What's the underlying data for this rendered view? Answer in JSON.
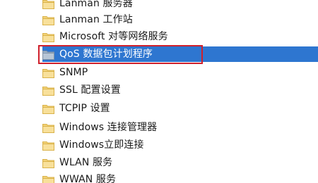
{
  "tree": {
    "items": [
      {
        "label": "Lanman 服务器",
        "icon": "folder-icon",
        "selected": false
      },
      {
        "label": "Lanman 工作站",
        "icon": "folder-icon",
        "selected": false
      },
      {
        "label": "Microsoft 对等网络服务",
        "icon": "folder-icon",
        "selected": false
      },
      {
        "label": "QoS 数据包计划程序",
        "icon": "folder-icon",
        "selected": true
      },
      {
        "label": "SNMP",
        "icon": "folder-icon",
        "selected": false
      },
      {
        "label": "SSL 配置设置",
        "icon": "folder-icon",
        "selected": false
      },
      {
        "label": "TCPIP 设置",
        "icon": "folder-icon",
        "selected": false
      },
      {
        "label": "Windows 连接管理器",
        "icon": "folder-icon",
        "selected": false
      },
      {
        "label": "Windows立即连接",
        "icon": "folder-icon",
        "selected": false
      },
      {
        "label": "WLAN 服务",
        "icon": "folder-icon",
        "selected": false
      },
      {
        "label": "WWAN 服务",
        "icon": "folder-icon",
        "selected": false
      }
    ]
  },
  "colors": {
    "selection": "#2e76d0",
    "highlight_border": "#d0202c",
    "folder": "#f3d277"
  }
}
